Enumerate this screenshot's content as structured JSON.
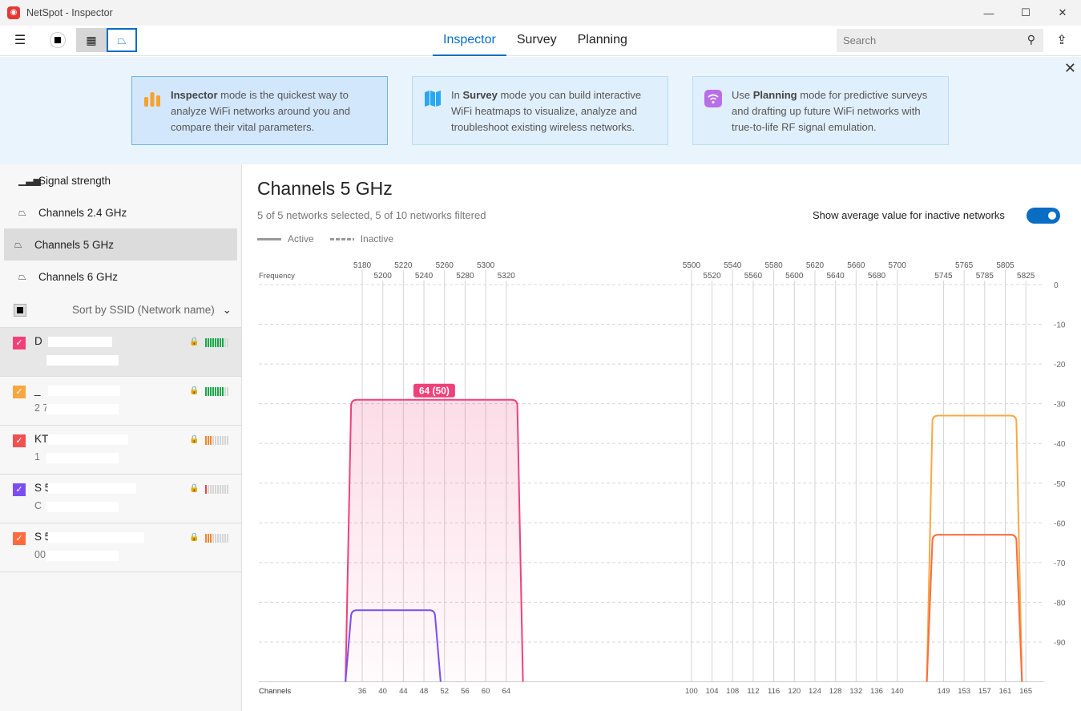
{
  "window": {
    "title": "NetSpot - Inspector",
    "minimize": "—",
    "maximize": "☐",
    "close": "✕"
  },
  "toolbar": {
    "tabs": [
      "Inspector",
      "Survey",
      "Planning"
    ],
    "active_tab": "Inspector",
    "search_placeholder": "Search"
  },
  "banner": {
    "cards": [
      {
        "bold": "Inspector",
        "text": " mode is the quickest way to analyze WiFi networks around you and compare their vital parameters.",
        "icon": "bar-chart-icon",
        "color": "#f7a22c"
      },
      {
        "pre": "In ",
        "bold": "Survey",
        "text": " mode you can build interactive WiFi heatmaps to visualize, analyze and troubleshoot existing wireless networks.",
        "icon": "map-icon",
        "color": "#29a8ef"
      },
      {
        "pre": "Use ",
        "bold": "Planning",
        "text": " mode for predictive surveys and drafting up future WiFi networks with true-to-life RF signal emulation.",
        "icon": "wifi-icon",
        "color": "#b86ee6"
      }
    ]
  },
  "sidebar": {
    "nav": [
      "Signal strength",
      "Channels 2.4 GHz",
      "Channels 5 GHz",
      "Channels 6 GHz"
    ],
    "active": "Channels 5 GHz",
    "sort_label": "Sort by SSID (Network name)",
    "networks": [
      {
        "name": "D",
        "mac": "",
        "color": "#f0407a",
        "signal_bars": 8,
        "bar_color": "#1aa84a",
        "selected": true
      },
      {
        "name": "_",
        "mac": "2 7",
        "color": "#f7a842",
        "signal_bars": 8,
        "bar_color": "#1aa84a"
      },
      {
        "name": "KT_ 19E",
        "mac": "1",
        "color": "#f2504f",
        "signal_bars": 3,
        "bar_color": "#f3862b"
      },
      {
        "name": "S 5G",
        "mac": "C",
        "color": "#7c4df2",
        "signal_bars": 1,
        "bar_color": "#e94545"
      },
      {
        "name": "S 5G",
        "mac": "00:",
        "color": "#ff6b3d",
        "signal_bars": 3,
        "bar_color": "#f3862b"
      }
    ]
  },
  "main": {
    "title": "Channels 5 GHz",
    "subtitle": "5 of 5 networks selected, 5 of 10 networks filtered",
    "toggle_label": "Show average value for inactive networks",
    "toggle_on": true,
    "legend_active": "Active",
    "legend_inactive": "Inactive"
  },
  "chart_data": {
    "type": "area",
    "xlabel_top": "Frequency",
    "xlabel_bottom": "Channels",
    "ylim": [
      -100,
      0
    ],
    "yticks": [
      0,
      -10,
      -20,
      -30,
      -40,
      -50,
      -60,
      -70,
      -80,
      -90
    ],
    "freq_ticks": [
      [
        36,
        "5180"
      ],
      [
        40,
        "5200"
      ],
      [
        44,
        "5220"
      ],
      [
        48,
        "5240"
      ],
      [
        52,
        "5260"
      ],
      [
        56,
        "5280"
      ],
      [
        60,
        "5300"
      ],
      [
        64,
        "5320"
      ],
      [
        100,
        "5500"
      ],
      [
        104,
        "5520"
      ],
      [
        108,
        "5540"
      ],
      [
        112,
        "5560"
      ],
      [
        116,
        "5580"
      ],
      [
        120,
        "5600"
      ],
      [
        124,
        "5620"
      ],
      [
        128,
        "5640"
      ],
      [
        132,
        "5660"
      ],
      [
        136,
        "5680"
      ],
      [
        140,
        "5700"
      ],
      [
        149,
        "5745"
      ],
      [
        153,
        "5765"
      ],
      [
        157,
        "5785"
      ],
      [
        161,
        "5805"
      ],
      [
        165,
        "5825"
      ]
    ],
    "channels": [
      36,
      40,
      44,
      48,
      52,
      56,
      60,
      64,
      100,
      104,
      108,
      112,
      116,
      120,
      124,
      128,
      132,
      136,
      140,
      149,
      153,
      157,
      161,
      165
    ],
    "series": [
      {
        "color": "#f0407a",
        "ch_from": 36,
        "ch_to": 64,
        "signal": -29,
        "label": "64 (50)",
        "filled": true
      },
      {
        "color": "#7c4df2",
        "ch_from": 36,
        "ch_to": 48,
        "signal": -82
      },
      {
        "color": "#f7a842",
        "ch_from": 149,
        "ch_to": 161,
        "signal": -33
      },
      {
        "color": "#ff6b3d",
        "ch_from": 149,
        "ch_to": 161,
        "signal": -63
      }
    ]
  }
}
